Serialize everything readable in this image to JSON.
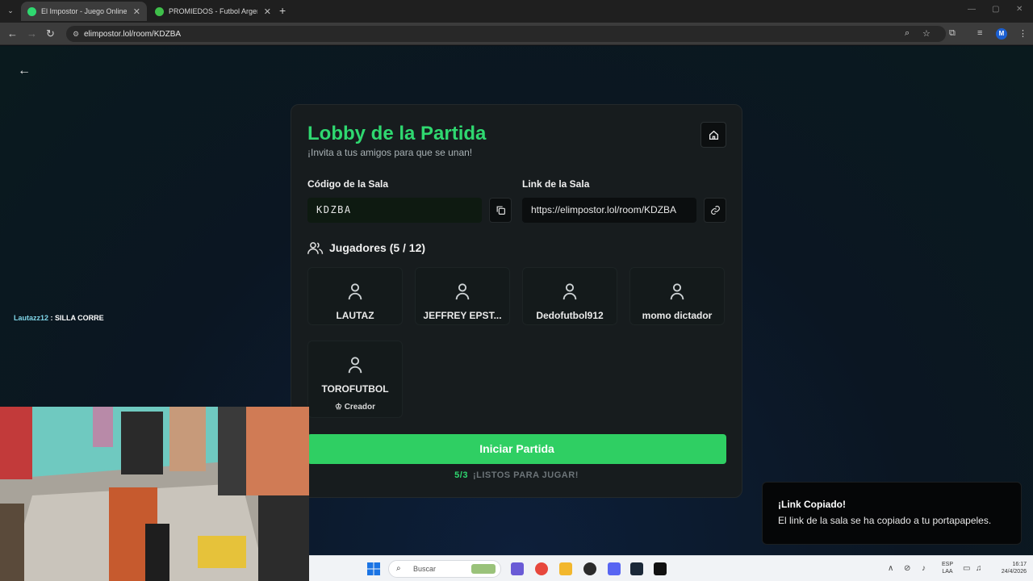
{
  "browser": {
    "tabs": [
      {
        "title": "El Impostor - Juego Online Gratis",
        "active": true,
        "favicon_color": "#2fd870"
      },
      {
        "title": "PROMIEDOS - Futbol Argentino",
        "active": false,
        "favicon_color": "#3fbf4a"
      }
    ],
    "url": "elimpostor.lol/room/KDZBA",
    "profile_initial": "M"
  },
  "chat": {
    "user": "Lautazz12",
    "separator": " : ",
    "message": "SILLA CORRE"
  },
  "lobby": {
    "title": "Lobby de la Partida",
    "subtitle": "¡Invita a tus amigos para que se unan!",
    "code_label": "Código de la Sala",
    "code_value": "KDZBA",
    "link_label": "Link de la Sala",
    "link_value": "https://elimpostor.lol/room/KDZBA",
    "players_heading": "Jugadores (5 / 12)",
    "players": [
      {
        "name": "LAUTAZ"
      },
      {
        "name": "JEFFREY EPST..."
      },
      {
        "name": "Dedofutbol912"
      },
      {
        "name": "momo dictador"
      },
      {
        "name": "TOROFUTBOL",
        "badge": "Creador"
      }
    ],
    "start_button": "Iniciar Partida",
    "ready_count": "5/3",
    "ready_text": "¡LISTOS PARA JUGAR!"
  },
  "toast": {
    "title": "¡Link Copiado!",
    "message": "El link de la sala se ha copiado a tu portapapeles."
  },
  "taskbar": {
    "search_placeholder": "Buscar",
    "lang_top": "ESP",
    "lang_bottom": "LAA",
    "time": "16:17",
    "date": "24/4/2026"
  },
  "colors": {
    "accent": "#2fd870",
    "start_button": "#2fcf63"
  }
}
